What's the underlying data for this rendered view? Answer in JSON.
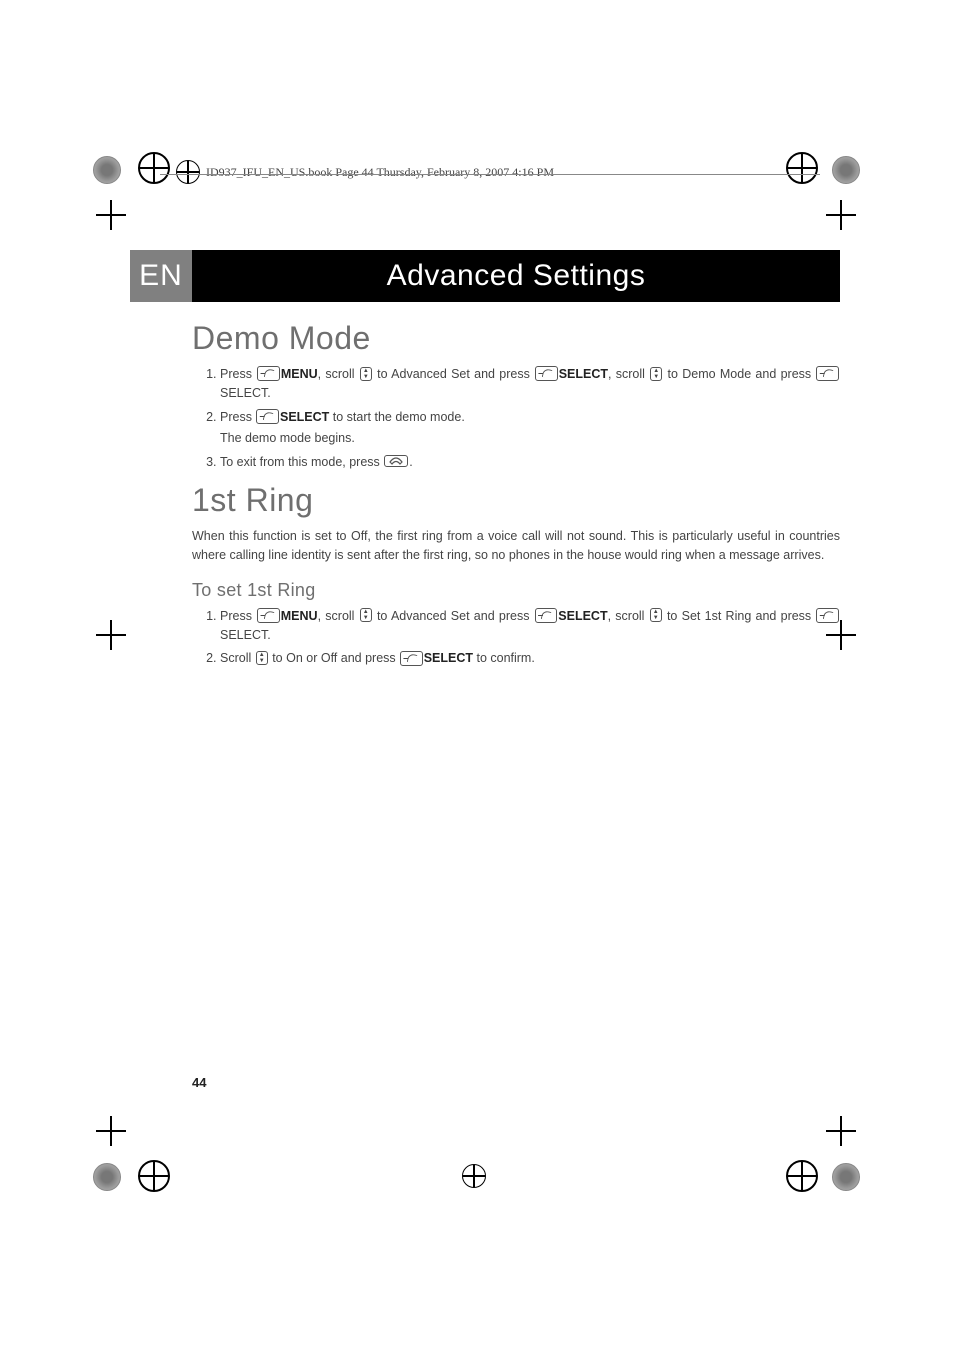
{
  "book_header": "ID937_IFU_EN_US.book  Page 44  Thursday, February 8, 2007  4:16 PM",
  "lang": "EN",
  "title": "Advanced Settings",
  "page_number": "44",
  "labels": {
    "menu": "MENU",
    "select_b": "SELECT",
    "select_p": "SELECT"
  },
  "sections": [
    {
      "heading": "Demo Mode",
      "steps": [
        {
          "parts": [
            "Press ",
            {
              "icon": "menu"
            },
            {
              "bold": "MENU"
            },
            ", scroll ",
            {
              "icon": "scroll"
            },
            " to Advanced Set and press ",
            {
              "icon": "menu"
            },
            {
              "bold": "SELECT"
            },
            ", scroll ",
            {
              "icon": "scroll"
            },
            " to Demo Mode and press ",
            {
              "icon": "menu"
            },
            "SELECT."
          ]
        },
        {
          "parts": [
            "Press ",
            {
              "icon": "menu"
            },
            {
              "bold": "SELECT"
            },
            " to start the demo mode."
          ],
          "sub": "The demo mode begins."
        },
        {
          "parts": [
            "To exit from this mode, press ",
            {
              "icon": "hang"
            },
            "."
          ]
        }
      ]
    },
    {
      "heading": "1st Ring",
      "intro": "When this function is set to Off, the first ring from a voice call will not sound. This is particularly useful in countries where calling line identity is sent after the first ring, so no phones in the house would ring when a message arrives.",
      "subheading": "To set 1st Ring",
      "steps": [
        {
          "parts": [
            "Press ",
            {
              "icon": "menu"
            },
            {
              "bold": "MENU"
            },
            ", scroll ",
            {
              "icon": "scroll"
            },
            " to Advanced Set and press ",
            {
              "icon": "menu"
            },
            {
              "bold": "SELECT"
            },
            ", scroll ",
            {
              "icon": "scroll"
            },
            " to Set 1st Ring and press ",
            {
              "icon": "menu"
            },
            "SELECT."
          ]
        },
        {
          "parts": [
            "Scroll ",
            {
              "icon": "scroll"
            },
            " to On or Off and press ",
            {
              "icon": "menu"
            },
            {
              "bold": "SELECT"
            },
            " to confirm."
          ]
        }
      ]
    }
  ]
}
